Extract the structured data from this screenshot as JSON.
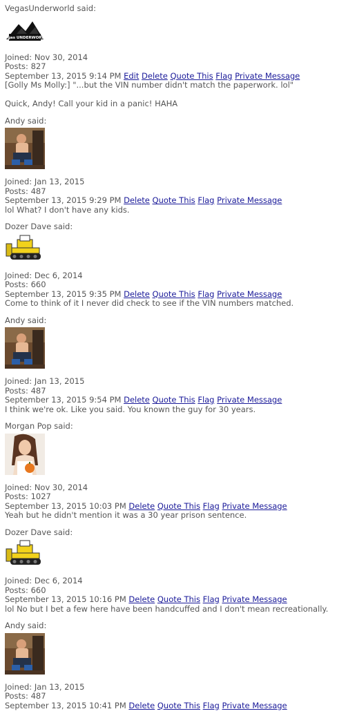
{
  "posts": [
    {
      "author": "VegasUnderworld",
      "said_suffix": " said:",
      "avatar": "logo",
      "joined": "Joined: Nov 30, 2014",
      "posts": "Posts: 827",
      "timestamp": "September 13, 2015 9:14 PM",
      "actions": [
        "Edit",
        "Delete",
        "Quote This",
        "Flag",
        "Private Message"
      ],
      "body": "[Golly Ms Molly:] \"...but the VIN number didn't match the paperwork. lol\"\n\nQuick, Andy! Call your kid in a panic! HAHA",
      "logo_text": "Vegas UNDERWORLD"
    },
    {
      "author": "Andy",
      "said_suffix": " said:",
      "avatar": "andy",
      "joined": "Joined: Jan 13, 2015",
      "posts": "Posts: 487",
      "timestamp": "September 13, 2015 9:29 PM",
      "actions": [
        "Delete",
        "Quote This",
        "Flag",
        "Private Message"
      ],
      "body": "lol What? I don't have any kids."
    },
    {
      "author": "Dozer Dave",
      "said_suffix": " said:",
      "avatar": "dozer",
      "joined": "Joined: Dec 6, 2014",
      "posts": "Posts: 660",
      "timestamp": "September 13, 2015 9:35 PM",
      "actions": [
        "Delete",
        "Quote This",
        "Flag",
        "Private Message"
      ],
      "body": "Come to think of it I never did check to see if the VIN numbers matched."
    },
    {
      "author": "Andy",
      "said_suffix": " said:",
      "avatar": "andy",
      "joined": "Joined: Jan 13, 2015",
      "posts": "Posts: 487",
      "timestamp": "September 13, 2015 9:54 PM",
      "actions": [
        "Delete",
        "Quote This",
        "Flag",
        "Private Message"
      ],
      "body": "I think we're ok. Like you said. You known the guy for 30 years."
    },
    {
      "author": "Morgan Pop",
      "said_suffix": " said:",
      "avatar": "morgan",
      "joined": "Joined: Nov 30, 2014",
      "posts": "Posts: 1027",
      "timestamp": "September 13, 2015 10:03 PM",
      "actions": [
        "Delete",
        "Quote This",
        "Flag",
        "Private Message"
      ],
      "body": "Yeah but he didn't mention it was a 30 year prison sentence."
    },
    {
      "author": "Dozer Dave",
      "said_suffix": " said:",
      "avatar": "dozer",
      "joined": "Joined: Dec 6, 2014",
      "posts": "Posts: 660",
      "timestamp": "September 13, 2015 10:16 PM",
      "actions": [
        "Delete",
        "Quote This",
        "Flag",
        "Private Message"
      ],
      "body": "lol No but I bet a few here have been handcuffed and I don't mean recreationally."
    },
    {
      "author": "Andy",
      "said_suffix": " said:",
      "avatar": "andy",
      "joined": "Joined: Jan 13, 2015",
      "posts": "Posts: 487",
      "timestamp": "September 13, 2015 10:41 PM",
      "actions": [
        "Delete",
        "Quote This",
        "Flag",
        "Private Message"
      ],
      "body": ""
    }
  ],
  "colors": {
    "text": "#555555",
    "link": "#1a1a99",
    "background": "#ffffff"
  }
}
